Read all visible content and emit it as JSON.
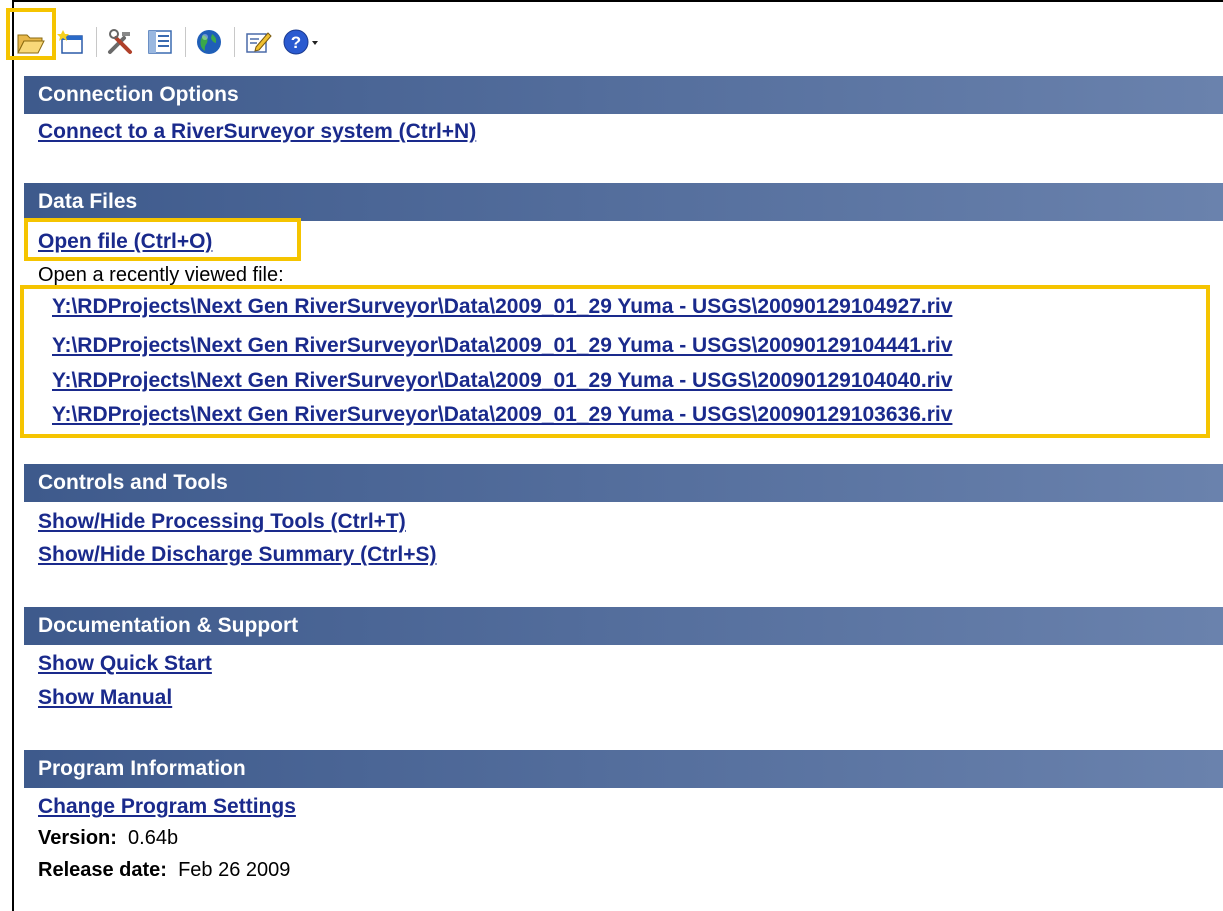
{
  "toolbar": {
    "buttons": [
      {
        "icon": "open-folder-icon"
      },
      {
        "icon": "new-window-icon"
      },
      {
        "icon": "tools-icon"
      },
      {
        "icon": "list-panel-icon"
      },
      {
        "icon": "globe-icon"
      },
      {
        "icon": "edit-document-icon"
      },
      {
        "icon": "help-icon"
      }
    ],
    "highlight_color": "#f5c400"
  },
  "sections": {
    "connection": {
      "title": "Connection Options",
      "links": [
        "Connect to a RiverSurveyor system (Ctrl+N)"
      ]
    },
    "data_files": {
      "title": "Data Files",
      "open_file": "Open file (Ctrl+O)",
      "recent_label": "Open a recently viewed file:",
      "recent_files": [
        "Y:\\RDProjects\\Next Gen RiverSurveyor\\Data\\2009_01_29 Yuma - USGS\\20090129104927.riv",
        "Y:\\RDProjects\\Next Gen RiverSurveyor\\Data\\2009_01_29 Yuma - USGS\\20090129104441.riv",
        "Y:\\RDProjects\\Next Gen RiverSurveyor\\Data\\2009_01_29 Yuma - USGS\\20090129104040.riv",
        "Y:\\RDProjects\\Next Gen RiverSurveyor\\Data\\2009_01_29 Yuma - USGS\\20090129103636.riv"
      ]
    },
    "controls": {
      "title": "Controls and Tools",
      "links": [
        "Show/Hide Processing Tools (Ctrl+T)",
        "Show/Hide Discharge Summary (Ctrl+S)"
      ]
    },
    "docs": {
      "title": "Documentation & Support",
      "links": [
        "Show Quick Start",
        "Show Manual"
      ]
    },
    "program": {
      "title": "Program Information",
      "settings_link": "Change Program Settings",
      "version_label": "Version:",
      "version_value": "0.64b",
      "release_label": "Release date:",
      "release_value": "Feb 26 2009"
    }
  },
  "colors": {
    "header_start": "#3e5a8c",
    "header_end": "#6a82ad",
    "link": "#1a2a8c",
    "highlight": "#f5c400"
  }
}
